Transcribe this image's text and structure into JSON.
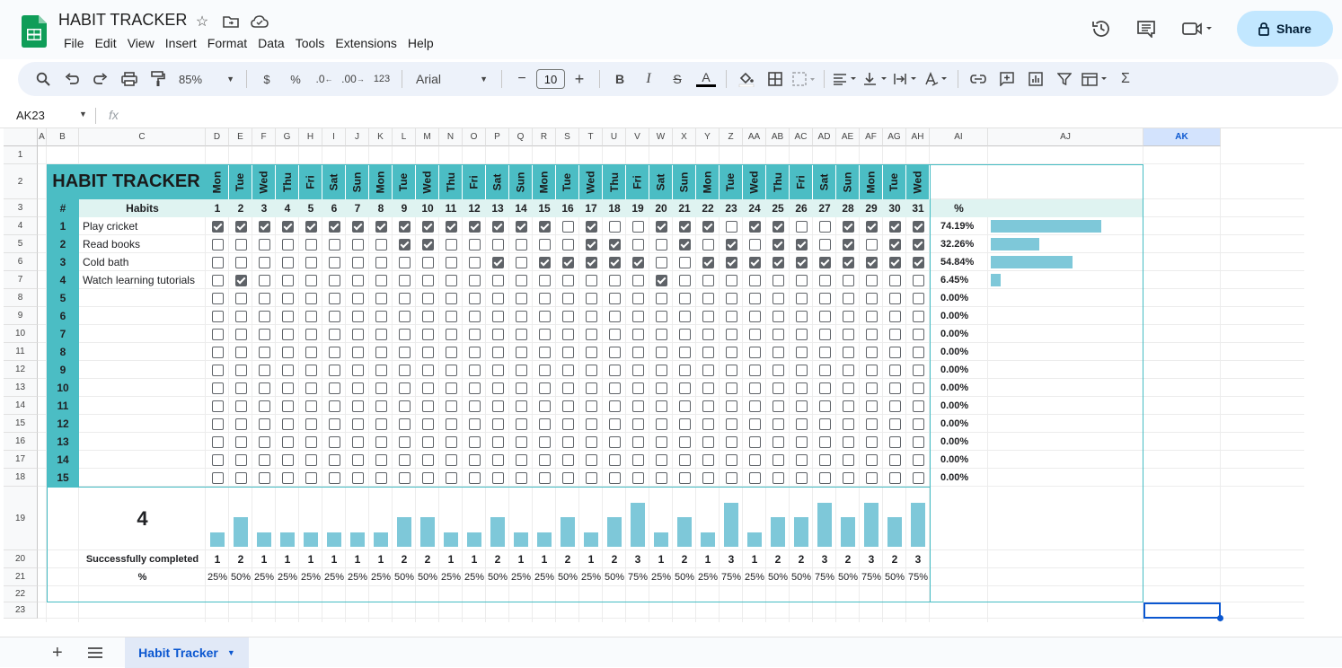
{
  "app": {
    "doc_title": "HABIT TRACKER"
  },
  "menu": [
    "File",
    "Edit",
    "View",
    "Insert",
    "Format",
    "Data",
    "Tools",
    "Extensions",
    "Help"
  ],
  "share_label": "Share",
  "toolbar": {
    "zoom": "85%",
    "currency": "$",
    "percent": "%",
    "dec_dec": ".0",
    "inc_dec": ".00",
    "num_format": "123",
    "font": "Arial",
    "font_size": "10",
    "minus": "−",
    "plus": "+",
    "bold": "B",
    "italic": "I",
    "strike": "S",
    "textcolor": "A",
    "sum": "Σ"
  },
  "formula": {
    "name_box": "AK23",
    "fx": "fx"
  },
  "columns": [
    "A",
    "B",
    "C",
    "D",
    "E",
    "F",
    "G",
    "H",
    "I",
    "J",
    "K",
    "L",
    "M",
    "N",
    "O",
    "P",
    "Q",
    "R",
    "S",
    "T",
    "U",
    "V",
    "W",
    "X",
    "Y",
    "Z",
    "AA",
    "AB",
    "AC",
    "AD",
    "AE",
    "AF",
    "AG",
    "AH",
    "AI",
    "AJ",
    "AK"
  ],
  "rows": [
    "1",
    "2",
    "3",
    "4",
    "5",
    "6",
    "7",
    "8",
    "9",
    "10",
    "11",
    "12",
    "13",
    "14",
    "15",
    "16",
    "17",
    "18",
    "19",
    "20",
    "21",
    "22",
    "23"
  ],
  "tracker": {
    "title": "HABIT TRACKER",
    "hash": "#",
    "habits_header": "Habits",
    "pct_header": "%",
    "weekdays": [
      "Mon",
      "Tue",
      "Wed",
      "Thu",
      "Fri",
      "Sat",
      "Sun",
      "Mon",
      "Tue",
      "Wed",
      "Thu",
      "Fri",
      "Sat",
      "Sun",
      "Mon",
      "Tue",
      "Wed",
      "Thu",
      "Fri",
      "Sat",
      "Sun",
      "Mon",
      "Tue",
      "Wed",
      "Thu",
      "Fri",
      "Sat",
      "Sun",
      "Mon",
      "Tue",
      "Wed"
    ],
    "days": [
      "1",
      "2",
      "3",
      "4",
      "5",
      "6",
      "7",
      "8",
      "9",
      "10",
      "11",
      "12",
      "13",
      "14",
      "15",
      "16",
      "17",
      "18",
      "19",
      "20",
      "21",
      "22",
      "23",
      "24",
      "25",
      "26",
      "27",
      "28",
      "29",
      "30",
      "31"
    ],
    "habit_rows": [
      {
        "num": "1",
        "name": "Play cricket",
        "pct": "74.19%",
        "pct_value": 74.19,
        "checks": "1111111111111110100111011001111"
      },
      {
        "num": "2",
        "name": "Read books",
        "pct": "32.26%",
        "pct_value": 32.26,
        "checks": "0000000011000000110010101101011"
      },
      {
        "num": "3",
        "name": "Cold bath",
        "pct": "54.84%",
        "pct_value": 54.84,
        "checks": "0000000000001011111001111111111"
      },
      {
        "num": "4",
        "name": "Watch learning tutorials",
        "pct": "6.45%",
        "pct_value": 6.45,
        "checks": "0100000000000000000100000000000"
      },
      {
        "num": "5",
        "name": "",
        "pct": "0.00%",
        "pct_value": 0,
        "checks": "0000000000000000000000000000000"
      },
      {
        "num": "6",
        "name": "",
        "pct": "0.00%",
        "pct_value": 0,
        "checks": "0000000000000000000000000000000"
      },
      {
        "num": "7",
        "name": "",
        "pct": "0.00%",
        "pct_value": 0,
        "checks": "0000000000000000000000000000000"
      },
      {
        "num": "8",
        "name": "",
        "pct": "0.00%",
        "pct_value": 0,
        "checks": "0000000000000000000000000000000"
      },
      {
        "num": "9",
        "name": "",
        "pct": "0.00%",
        "pct_value": 0,
        "checks": "0000000000000000000000000000000"
      },
      {
        "num": "10",
        "name": "",
        "pct": "0.00%",
        "pct_value": 0,
        "checks": "0000000000000000000000000000000"
      },
      {
        "num": "11",
        "name": "",
        "pct": "0.00%",
        "pct_value": 0,
        "checks": "0000000000000000000000000000000"
      },
      {
        "num": "12",
        "name": "",
        "pct": "0.00%",
        "pct_value": 0,
        "checks": "0000000000000000000000000000000"
      },
      {
        "num": "13",
        "name": "",
        "pct": "0.00%",
        "pct_value": 0,
        "checks": "0000000000000000000000000000000"
      },
      {
        "num": "14",
        "name": "",
        "pct": "0.00%",
        "pct_value": 0,
        "checks": "0000000000000000000000000000000"
      },
      {
        "num": "15",
        "name": "",
        "pct": "0.00%",
        "pct_value": 0,
        "checks": "0000000000000000000000000000000"
      }
    ],
    "habit_count": "4",
    "completed_label": "Successfully completed",
    "pct_label": "%",
    "completed": [
      "1",
      "2",
      "1",
      "1",
      "1",
      "1",
      "1",
      "1",
      "2",
      "2",
      "1",
      "1",
      "2",
      "1",
      "1",
      "2",
      "1",
      "2",
      "3",
      "1",
      "2",
      "1",
      "3",
      "1",
      "2",
      "2",
      "3",
      "2",
      "3",
      "2",
      "3"
    ],
    "completed_pct": [
      "25%",
      "50%",
      "25%",
      "25%",
      "25%",
      "25%",
      "25%",
      "25%",
      "50%",
      "50%",
      "25%",
      "25%",
      "50%",
      "25%",
      "25%",
      "50%",
      "25%",
      "50%",
      "75%",
      "25%",
      "50%",
      "25%",
      "75%",
      "25%",
      "50%",
      "50%",
      "75%",
      "50%",
      "75%",
      "50%",
      "75%"
    ]
  },
  "sheet_tab": "Habit Tracker",
  "colors": {
    "teal": "#4bbdc4",
    "light_teal": "#dff3f1",
    "bar": "#7ec8d9",
    "share_bg": "#c2e7ff",
    "selection": "#0b57d0"
  }
}
